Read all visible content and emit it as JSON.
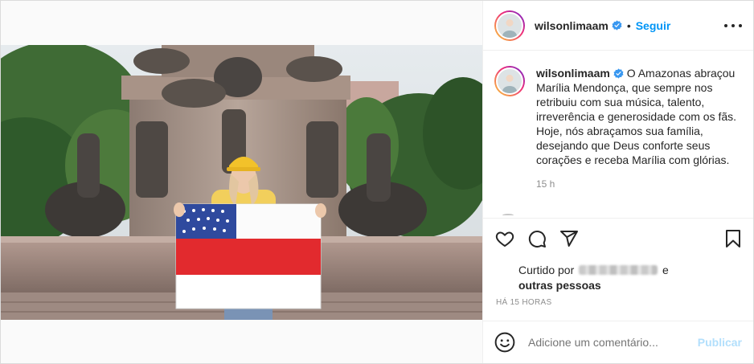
{
  "post": {
    "username": "wilsonlimaam",
    "follow_label": "Seguir",
    "separator": "•",
    "caption": "O Amazonas abraçou Marília Mendonça, que sempre nos retribuiu com sua música, talento, irreverência e generosidade com os fãs. Hoje, nós abraçamos sua família, desejando que Deus conforte seus corações e receba Marília com glórias.",
    "caption_time": "15 h",
    "liked_by_prefix": "Curtido por",
    "liked_by_suffix": "e",
    "liked_by_others": "outras pessoas",
    "timestamp": "HÁ 15 HORAS",
    "comment_placeholder": "Adicione um comentário...",
    "publish_label": "Publicar"
  },
  "icons": {
    "more": "more-options-icon",
    "like": "heart-icon",
    "comment": "comment-icon",
    "share": "share-icon",
    "save": "bookmark-icon",
    "emoji": "emoji-icon",
    "verified": "verified-badge-icon"
  },
  "colors": {
    "accent": "#0095f6",
    "publish_disabled": "#b2dffc",
    "muted_text": "#8e8e8e",
    "verified": "#3897f0"
  }
}
